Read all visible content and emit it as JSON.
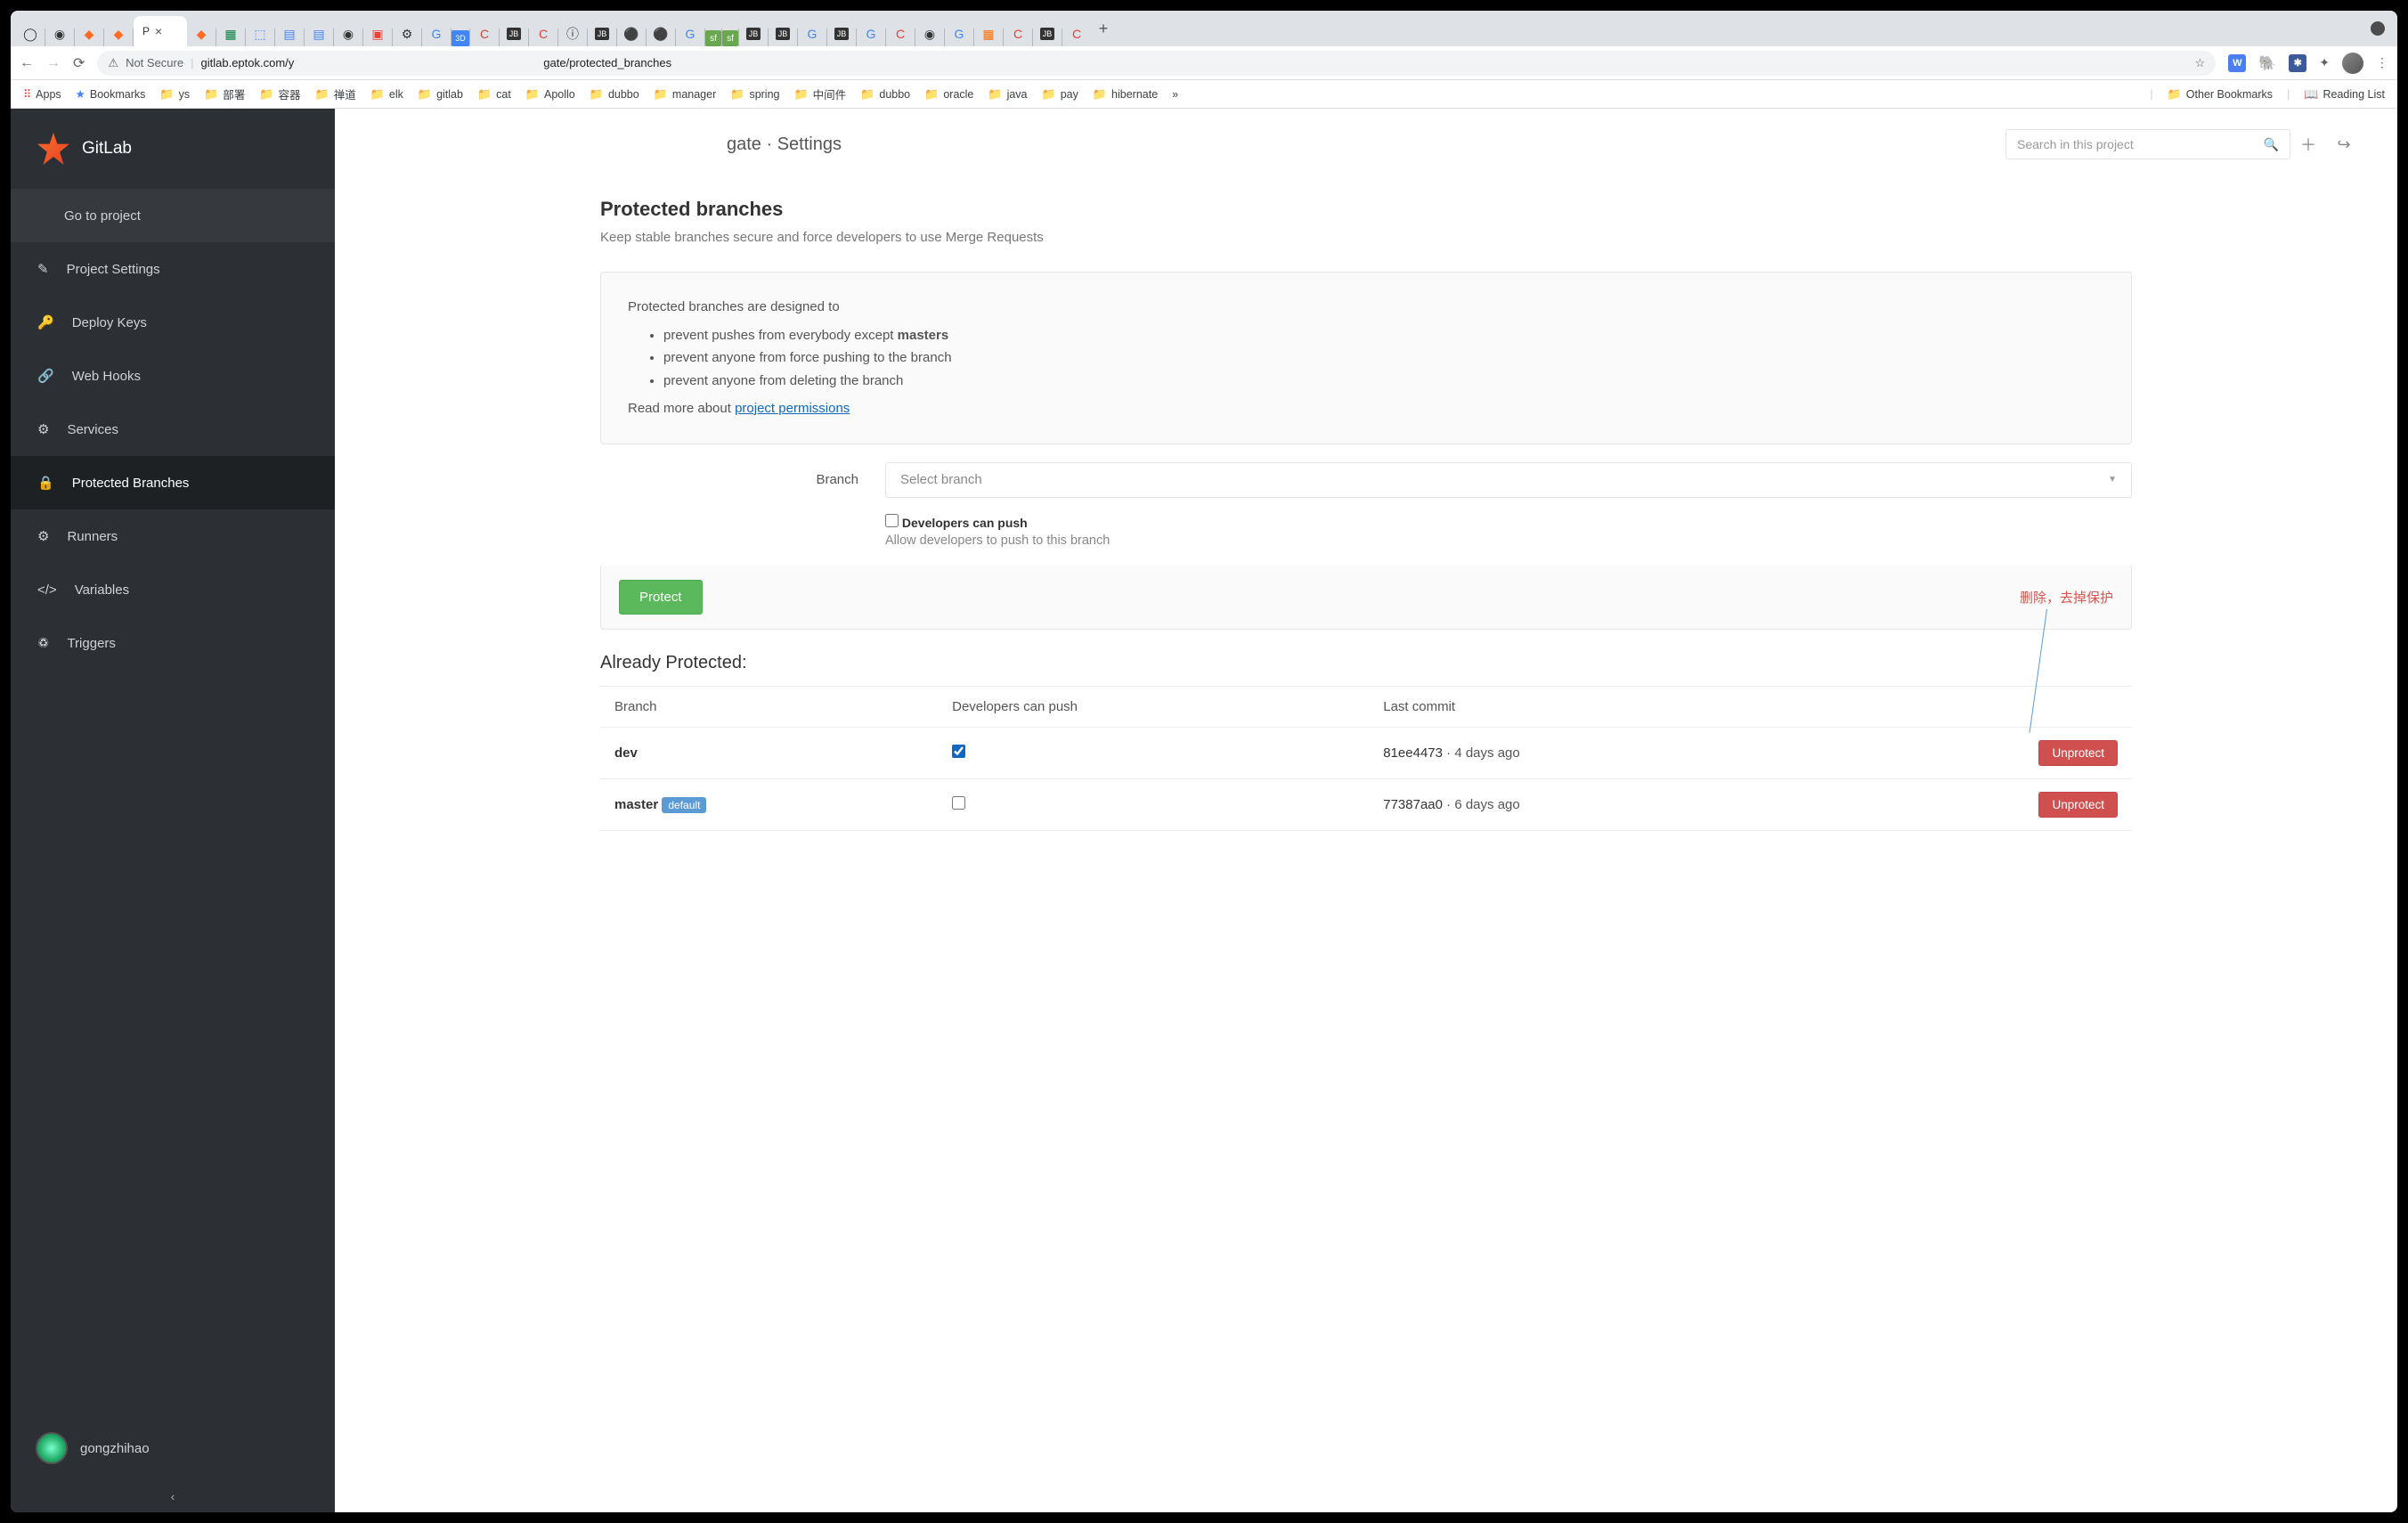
{
  "browser": {
    "active_tab_label": "P",
    "url_security": "Not Secure",
    "url_host": "gitlab.eptok.com/y",
    "url_path": "gate/protected_branches",
    "apps_label": "Apps",
    "bookmarks_label": "Bookmarks",
    "bookmark_folders": [
      "ys",
      "部署",
      "容器",
      "禅道",
      "elk",
      "gitlab",
      "cat",
      "Apollo",
      "dubbo",
      "manager",
      "spring",
      "中间件",
      "dubbo",
      "oracle",
      "java",
      "pay",
      "hibernate"
    ],
    "bookmarks_overflow": "»",
    "other_bookmarks": "Other Bookmarks",
    "reading_list": "Reading List"
  },
  "sidebar": {
    "brand": "GitLab",
    "go_to_project": "Go to project",
    "items": [
      {
        "label": "Project Settings"
      },
      {
        "label": "Deploy Keys"
      },
      {
        "label": "Web Hooks"
      },
      {
        "label": "Services"
      },
      {
        "label": "Protected Branches"
      },
      {
        "label": "Runners"
      },
      {
        "label": "Variables"
      },
      {
        "label": "Triggers"
      }
    ],
    "username": "gongzhihao"
  },
  "header": {
    "breadcrumb": "gate · Settings",
    "search_placeholder": "Search in this project"
  },
  "page": {
    "title": "Protected branches",
    "subtitle": "Keep stable branches secure and force developers to use Merge Requests",
    "info_intro": "Protected branches are designed to",
    "info_bullet1_a": "prevent pushes from everybody except ",
    "info_bullet1_b": "masters",
    "info_bullet2": "prevent anyone from force pushing to the branch",
    "info_bullet3": "prevent anyone from deleting the branch",
    "info_readmore": "Read more about ",
    "info_link": "project permissions",
    "branch_label": "Branch",
    "select_placeholder": "Select branch",
    "dev_push_label": "Developers can push",
    "dev_push_desc": "Allow developers to push to this branch",
    "protect_btn": "Protect",
    "annotation": "删除，去掉保护",
    "already_heading": "Already Protected:",
    "table": {
      "headers": [
        "Branch",
        "Developers can push",
        "Last commit",
        ""
      ],
      "rows": [
        {
          "branch": "dev",
          "default": false,
          "checked": true,
          "hash": "81ee4473",
          "time": "4 days ago",
          "action": "Unprotect"
        },
        {
          "branch": "master",
          "default": true,
          "default_label": "default",
          "checked": false,
          "hash": "77387aa0",
          "time": "6 days ago",
          "action": "Unprotect"
        }
      ]
    }
  }
}
